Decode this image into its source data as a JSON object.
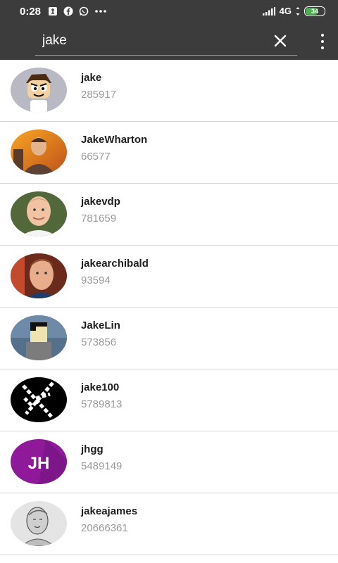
{
  "status_bar": {
    "time": "0:28",
    "network": "4G",
    "battery": "34"
  },
  "search": {
    "value": "jake"
  },
  "icons": {
    "clear": "close-icon",
    "menu": "more-vert-icon"
  },
  "colors": {
    "toolbar": "#3c3c3c",
    "battery": "#4caf50",
    "jhgg_avatar": "#8e1a9a"
  },
  "users": [
    {
      "name": "jake",
      "id": "285917"
    },
    {
      "name": "JakeWharton",
      "id": "66577"
    },
    {
      "name": "jakevdp",
      "id": "781659"
    },
    {
      "name": "jakearchibald",
      "id": "93594"
    },
    {
      "name": "JakeLin",
      "id": "573856"
    },
    {
      "name": "jake100",
      "id": "5789813"
    },
    {
      "name": "jhgg",
      "id": "5489149",
      "avatar_initials": "JH"
    },
    {
      "name": "jakeajames",
      "id": "20666361"
    }
  ]
}
